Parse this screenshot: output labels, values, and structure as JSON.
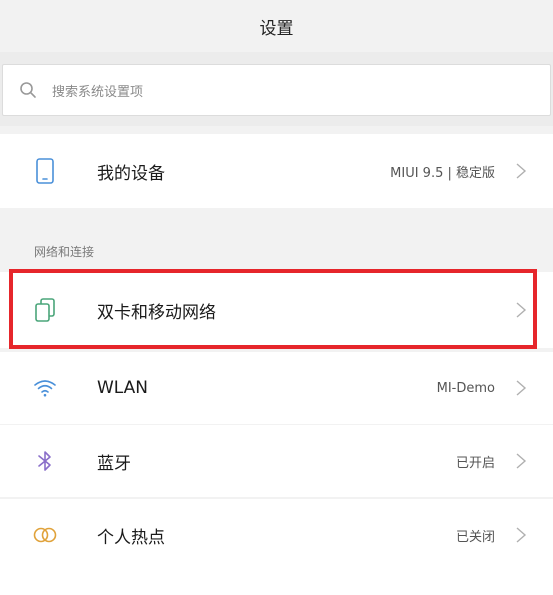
{
  "header": {
    "title": "设置"
  },
  "search": {
    "placeholder": "搜索系统设置项",
    "icon": "search-icon"
  },
  "device": {
    "label": "我的设备",
    "value": "MIUI 9.5 | 稳定版",
    "icon": "phone-icon"
  },
  "network_section": {
    "title": "网络和连接",
    "items": [
      {
        "label": "双卡和移动网络",
        "value": "",
        "icon": "sim-card-icon"
      },
      {
        "label": "WLAN",
        "value": "MI-Demo",
        "icon": "wifi-icon"
      },
      {
        "label": "蓝牙",
        "value": "已开启",
        "icon": "bluetooth-icon"
      },
      {
        "label": "个人热点",
        "value": "已关闭",
        "icon": "hotspot-icon"
      }
    ]
  },
  "colors": {
    "accent_icon": "#4a90d9",
    "highlight": "#e6262b"
  }
}
